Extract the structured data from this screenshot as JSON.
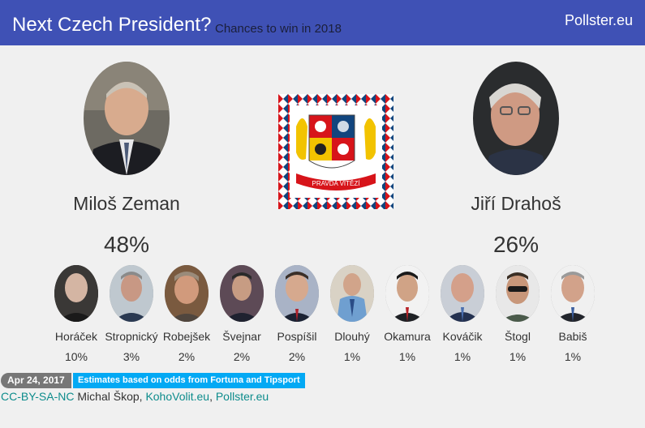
{
  "header": {
    "title": "Next Czech President?",
    "subtitle": "Chances to win in 2018",
    "brand": "Pollster.eu"
  },
  "leaders": [
    {
      "name": "Miloš Zeman",
      "percent": "48%"
    },
    {
      "name": "Jiří Drahoš",
      "percent": "26%"
    }
  ],
  "flag": {
    "motto": "PRAVDA VÍTĚZÍ"
  },
  "candidates": [
    {
      "name": "Horáček",
      "percent": "10%"
    },
    {
      "name": "Stropnický",
      "percent": "3%"
    },
    {
      "name": "Robejšek",
      "percent": "2%"
    },
    {
      "name": "Švejnar",
      "percent": "2%"
    },
    {
      "name": "Pospíšil",
      "percent": "2%"
    },
    {
      "name": "Dlouhý",
      "percent": "1%"
    },
    {
      "name": "Okamura",
      "percent": "1%"
    },
    {
      "name": "Kováčik",
      "percent": "1%"
    },
    {
      "name": "Štogl",
      "percent": "1%"
    },
    {
      "name": "Babiš",
      "percent": "1%"
    }
  ],
  "footer": {
    "date": "Apr 24, 2017",
    "note": "Estimates based on odds from Fortuna and Tipsport",
    "license": "CC-BY-SA-NC",
    "author": " Michal Škop, ",
    "link1": "KohoVolit.eu",
    "sep": ", ",
    "link2": "Pollster.eu"
  },
  "colors": {
    "header": "#3f51b5",
    "badge_date": "#777777",
    "badge_note": "#03a9f4",
    "link": "#0d8c8c"
  }
}
